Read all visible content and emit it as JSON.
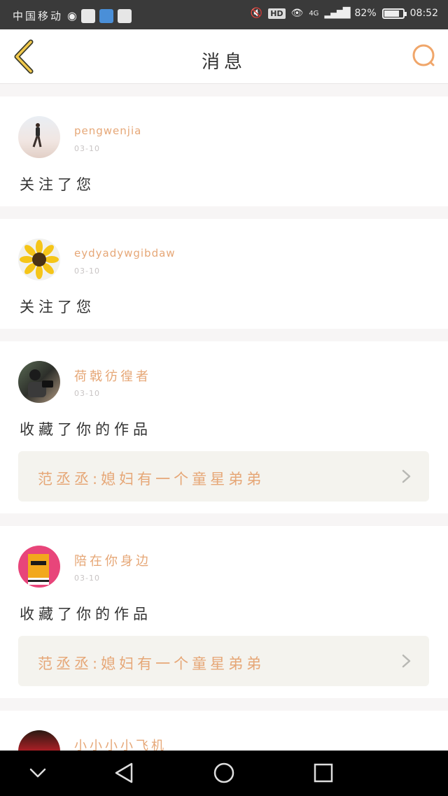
{
  "status_bar": {
    "carrier": "中国移动",
    "network": "4G",
    "battery": "82%",
    "battery_level": 0.82,
    "time": "08:52",
    "hd": "HD"
  },
  "header": {
    "title": "消息"
  },
  "items": [
    {
      "username": "pengwenjia",
      "date": "03-10",
      "action": "关注了您"
    },
    {
      "username": "eydyadywgibdaw",
      "date": "03-10",
      "action": "关注了您"
    },
    {
      "username": "荷戟彷徨者",
      "date": "03-10",
      "action": "收藏了你的作品",
      "work": "范丞丞:媳妇有一个童星弟弟"
    },
    {
      "username": "陪在你身边",
      "date": "03-10",
      "action": "收藏了你的作品",
      "work": "范丞丞:媳妇有一个童星弟弟"
    },
    {
      "username": "小小小小飞机"
    }
  ],
  "icons": {
    "back": "back-chevron-icon",
    "search": "search-icon",
    "nav_down": "chevron-down-icon",
    "nav_back": "triangle-back-icon",
    "nav_home": "circle-home-icon",
    "nav_recent": "square-recent-icon"
  },
  "colors": {
    "accent": "#e6a777",
    "back_icon": "#f2c94c",
    "work_bg": "#f4f3ee"
  }
}
